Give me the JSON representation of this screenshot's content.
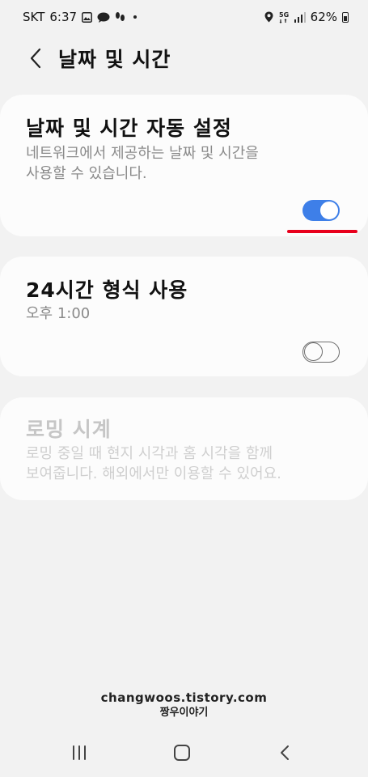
{
  "status_bar": {
    "carrier": "SKT",
    "time": "6:37",
    "battery": "62%",
    "icons_left": [
      "image-icon",
      "chat-icon",
      "steps-icon",
      "dot-icon"
    ],
    "icons_right": [
      "location-icon",
      "5g-icon",
      "signal-icon",
      "battery-icon"
    ]
  },
  "header": {
    "title": "날짜 및 시간",
    "back_icon": "chevron-left-icon"
  },
  "settings": [
    {
      "title": "날짜 및 시간 자동 설정",
      "description": "네트워크에서 제공하는 날짜 및 시간을\n사용할 수 있습니다.",
      "toggle": "on",
      "enabled": true
    },
    {
      "title": "24시간 형식 사용",
      "description": "오후 1:00",
      "toggle": "off",
      "enabled": true
    },
    {
      "title": "로밍 시계",
      "description": "로밍 중일 때 현지 시각과 홈 시각을 함께\n보여줍니다. 해외에서만 이용할 수 있어요.",
      "enabled": false
    }
  ],
  "watermark": {
    "site": "changwoos.tistory.com",
    "name": "짱우이야기"
  },
  "colors": {
    "accent": "#3e7fe8",
    "highlight_underline": "#e8001c",
    "background": "#f2f2f2",
    "card": "#fcfcfc"
  },
  "nav_bar": [
    "recent-apps-icon",
    "home-icon",
    "back-icon"
  ]
}
